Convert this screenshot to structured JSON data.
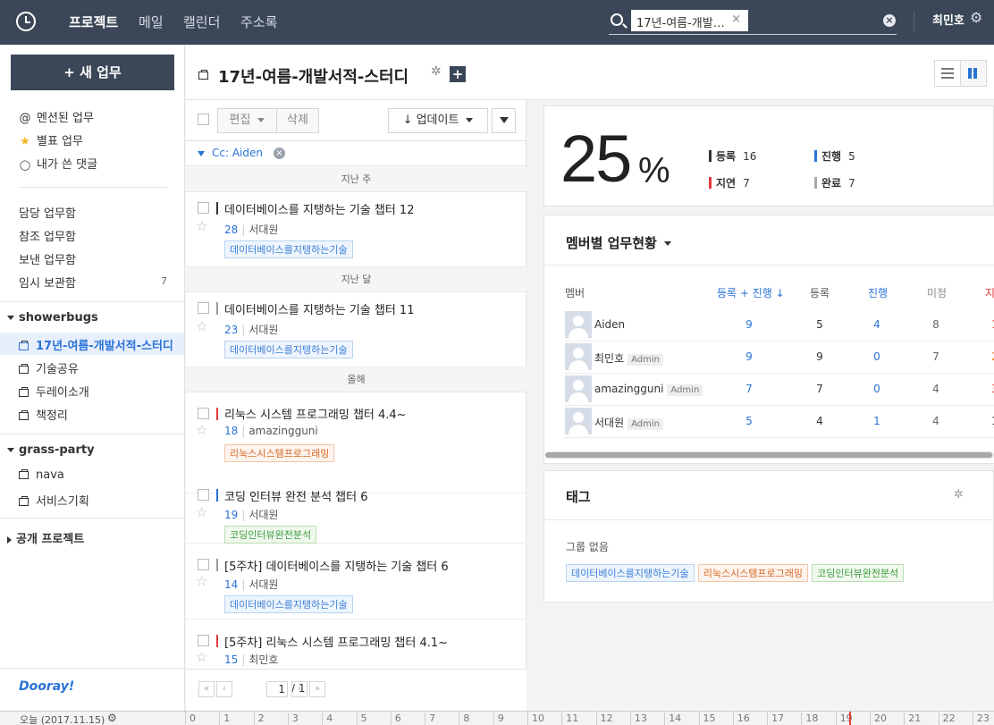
{
  "topbar": {
    "nav": [
      "프로젝트",
      "메일",
      "캘린더",
      "주소록"
    ],
    "search_chip": "17년-여름-개발…",
    "chip_close": "×",
    "search_clear": "×",
    "user_name": "최민호",
    "gear_icon": "⚙"
  },
  "sidebar": {
    "new_task": "+ 새 업무",
    "quick": [
      {
        "icon": "@",
        "label": "멘션된 업무"
      },
      {
        "icon": "★",
        "label": "별표 업무"
      },
      {
        "icon": "◯",
        "label": "내가 쓴 댓글"
      }
    ],
    "boxes": [
      {
        "label": "담당 업무함",
        "count": ""
      },
      {
        "label": "참조 업무함",
        "count": ""
      },
      {
        "label": "보낸 업무함",
        "count": ""
      },
      {
        "label": "임시 보관함",
        "count": "7"
      }
    ],
    "groups": [
      {
        "title": "showerbugs",
        "projects": [
          "17년-여름-개발서적-스터디",
          "기술공유",
          "두레이소개",
          "책정리"
        ]
      },
      {
        "title": "grass-party",
        "projects": [
          "nava",
          "서비스기획"
        ]
      }
    ],
    "public_projects": "공개 프로젝트",
    "brand": "Dooray!"
  },
  "project": {
    "title": "17년-여름-개발서적-스터디",
    "gear": "✲",
    "plus": "+"
  },
  "list": {
    "toolbar": {
      "edit": "편집",
      "delete": "삭제",
      "sort": "↓ 업데이트"
    },
    "filter": "Cc: Aiden",
    "filter_x": "×",
    "sections": [
      {
        "label": "지난 주"
      },
      {
        "label": "지난 달"
      },
      {
        "label": "올해"
      }
    ],
    "tasks": [
      {
        "title": "데이터베이스를 지탱하는 기술 챕터 12",
        "num": "28",
        "assignee": "서대원",
        "tag": "데이터베이스를지탱하는기술",
        "tag_color": "blue",
        "prio_color": "#333333"
      },
      {
        "title": "데이터베이스를 지탱하는 기술 챕터 11",
        "num": "23",
        "assignee": "서대원",
        "tag": "데이터베이스를지탱하는기술",
        "tag_color": "blue",
        "prio_color": "#999999"
      },
      {
        "title": "리눅스 시스템 프로그래밍 챕터 4.4~",
        "num": "18",
        "assignee": "amazingguni",
        "tag": "리눅스시스템프로그래밍",
        "tag_color": "orange",
        "prio_color": "#e23b3b"
      },
      {
        "title": "코딩 인터뷰 완전 분석 챕터 6",
        "num": "19",
        "assignee": "서대원",
        "tag": "코딩인터뷰완전분석",
        "tag_color": "green",
        "prio_color": "#2a73d6"
      },
      {
        "title": "[5주차] 데이터베이스를 지탱하는 기술 챕터 6",
        "num": "14",
        "assignee": "서대원",
        "tag": "데이터베이스를지탱하는기술",
        "tag_color": "blue",
        "prio_color": "#999999"
      },
      {
        "title": "[5주차] 리눅스 시스템 프로그래밍 챕터 4.1~",
        "num": "15",
        "assignee": "최민호",
        "tag": "",
        "tag_color": "",
        "prio_color": "#e23b3b"
      }
    ],
    "pager": {
      "first": "«",
      "prev": "‹",
      "next": "›",
      "last": "»",
      "page": "1",
      "total": "/ 1"
    }
  },
  "progress": {
    "percent_value": 25,
    "percent": "25",
    "percent_sign": "%",
    "stats": [
      {
        "label": "등록",
        "value": "16",
        "color": "#333333"
      },
      {
        "label": "진행",
        "value": "5",
        "color": "#2a73d6"
      },
      {
        "label": "지연",
        "value": "7",
        "color": "#e23b3b"
      },
      {
        "label": "완료",
        "value": "7",
        "color": "#aaaaaa"
      }
    ]
  },
  "members": {
    "title": "멤버별 업무현황",
    "headers": [
      "멤버",
      "등록 + 진행 ↓",
      "등록",
      "진행",
      "미정",
      "지"
    ],
    "rows": [
      {
        "name": "Aiden",
        "admin": "",
        "total": "9",
        "reg": "5",
        "prog": "4",
        "undecided": "8",
        "delay": "1"
      },
      {
        "name": "최민호",
        "admin": "Admin",
        "total": "9",
        "reg": "9",
        "prog": "0",
        "undecided": "7",
        "delay": "2"
      },
      {
        "name": "amazingguni",
        "admin": "Admin",
        "total": "7",
        "reg": "7",
        "prog": "0",
        "undecided": "4",
        "delay": "3"
      },
      {
        "name": "서대원",
        "admin": "Admin",
        "total": "5",
        "reg": "4",
        "prog": "1",
        "undecided": "4",
        "delay": "1"
      }
    ]
  },
  "tags": {
    "title": "태그",
    "group": "그룹 없음",
    "items": [
      {
        "label": "데이터베이스를지탱하는기술",
        "color": "blue"
      },
      {
        "label": "리눅스시스템프로그래밍",
        "color": "orange"
      },
      {
        "label": "코딩인터뷰완전분석",
        "color": "green"
      }
    ]
  },
  "timeline": {
    "today": "오늘 (2017.11.15)",
    "hours": [
      "0",
      "1",
      "2",
      "3",
      "4",
      "5",
      "6",
      "7",
      "8",
      "9",
      "10",
      "11",
      "12",
      "13",
      "14",
      "15",
      "16",
      "17",
      "18",
      "19",
      "20",
      "21",
      "22",
      "23"
    ]
  }
}
